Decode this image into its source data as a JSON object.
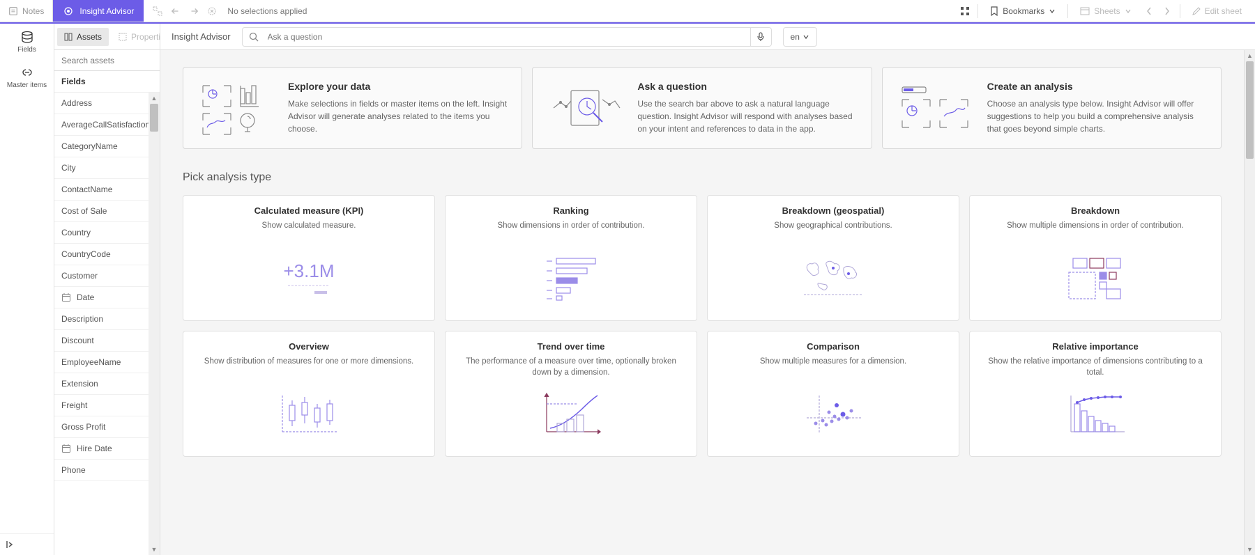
{
  "topbar": {
    "notes": "Notes",
    "insight_advisor": "Insight Advisor",
    "no_selections": "No selections applied",
    "bookmarks": "Bookmarks",
    "sheets": "Sheets",
    "edit_sheet": "Edit sheet"
  },
  "leftnav": {
    "fields": "Fields",
    "master_items": "Master items"
  },
  "assets": {
    "tab_assets": "Assets",
    "tab_properties": "Properties",
    "search_placeholder": "Search assets",
    "fields_header": "Fields",
    "items": [
      {
        "label": "Address",
        "has_icon": false
      },
      {
        "label": "AverageCallSatisfaction",
        "has_icon": false
      },
      {
        "label": "CategoryName",
        "has_icon": false
      },
      {
        "label": "City",
        "has_icon": false
      },
      {
        "label": "ContactName",
        "has_icon": false
      },
      {
        "label": "Cost of Sale",
        "has_icon": false
      },
      {
        "label": "Country",
        "has_icon": false
      },
      {
        "label": "CountryCode",
        "has_icon": false
      },
      {
        "label": "Customer",
        "has_icon": false
      },
      {
        "label": "Date",
        "has_icon": true
      },
      {
        "label": "Description",
        "has_icon": false
      },
      {
        "label": "Discount",
        "has_icon": false
      },
      {
        "label": "EmployeeName",
        "has_icon": false
      },
      {
        "label": "Extension",
        "has_icon": false
      },
      {
        "label": "Freight",
        "has_icon": false
      },
      {
        "label": "Gross Profit",
        "has_icon": false
      },
      {
        "label": "Hire Date",
        "has_icon": true
      },
      {
        "label": "Phone",
        "has_icon": false
      }
    ]
  },
  "content": {
    "title": "Insight Advisor",
    "search_placeholder": "Ask a question",
    "lang": "en"
  },
  "intro": [
    {
      "title": "Explore your data",
      "desc": "Make selections in fields or master items on the left. Insight Advisor will generate analyses related to the items you choose."
    },
    {
      "title": "Ask a question",
      "desc": "Use the search bar above to ask a natural language question. Insight Advisor will respond with analyses based on your intent and references to data in the app."
    },
    {
      "title": "Create an analysis",
      "desc": "Choose an analysis type below. Insight Advisor will offer suggestions to help you build a comprehensive analysis that goes beyond simple charts."
    }
  ],
  "section_title": "Pick analysis type",
  "analysis": [
    {
      "title": "Calculated measure (KPI)",
      "desc": "Show calculated measure."
    },
    {
      "title": "Ranking",
      "desc": "Show dimensions in order of contribution."
    },
    {
      "title": "Breakdown (geospatial)",
      "desc": "Show geographical contributions."
    },
    {
      "title": "Breakdown",
      "desc": "Show multiple dimensions in order of contribution."
    },
    {
      "title": "Overview",
      "desc": "Show distribution of measures for one or more dimensions."
    },
    {
      "title": "Trend over time",
      "desc": "The performance of a measure over time, optionally broken down by a dimension."
    },
    {
      "title": "Comparison",
      "desc": "Show multiple measures for a dimension."
    },
    {
      "title": "Relative importance",
      "desc": "Show the relative importance of dimensions contributing to a total."
    }
  ],
  "kpi_value": "+3.1M"
}
